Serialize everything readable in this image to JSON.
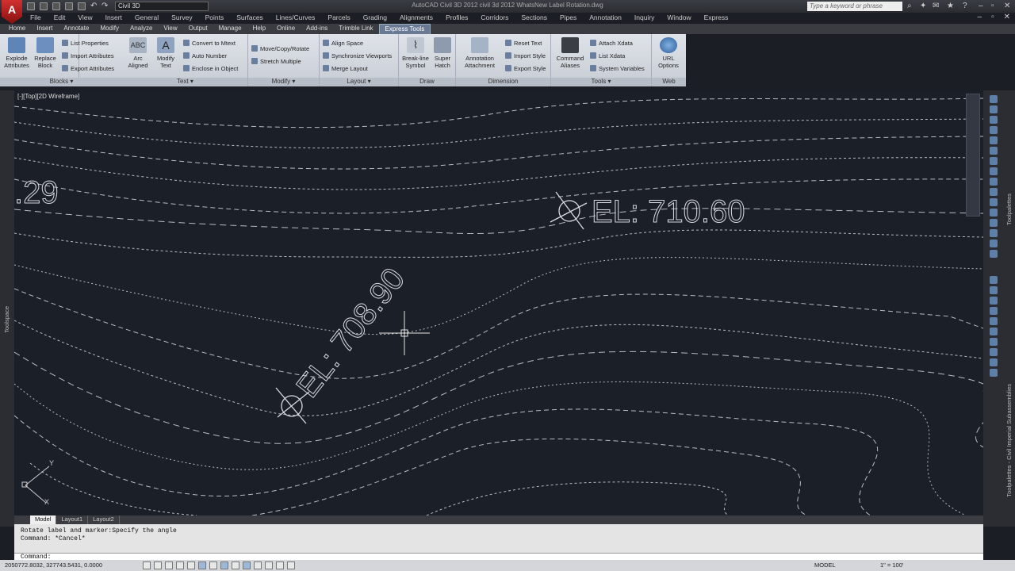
{
  "app": {
    "logo": "A",
    "title": "AutoCAD Civil 3D 2012   civil 3d 2012 WhatsNew Label Rotation.dwg",
    "workspace": "Civil 3D",
    "search_placeholder": "Type a keyword or phrase"
  },
  "menu": [
    "File",
    "Edit",
    "View",
    "Insert",
    "General",
    "Survey",
    "Points",
    "Surfaces",
    "Lines/Curves",
    "Parcels",
    "Grading",
    "Alignments",
    "Profiles",
    "Corridors",
    "Sections",
    "Pipes",
    "Annotation",
    "Inquiry",
    "Window",
    "Express"
  ],
  "ribbon_tabs": [
    "Home",
    "Insert",
    "Annotate",
    "Modify",
    "Analyze",
    "View",
    "Output",
    "Manage",
    "Help",
    "Online",
    "Add-ins",
    "Trimble Link",
    "Express Tools"
  ],
  "active_tab": "Express Tools",
  "ribbon": {
    "blocks": {
      "title": "Blocks",
      "explode": "Explode Attributes",
      "replace": "Replace Block",
      "list_props": "List Properties",
      "import_attr": "Import Attributes",
      "export_attr": "Export Attributes"
    },
    "text": {
      "title": "Text",
      "arc": "Arc Aligned",
      "modify": "Modify Text",
      "convert": "Convert to Mtext",
      "auto_number": "Auto Number",
      "enclose": "Enclose in Object"
    },
    "modify": {
      "title": "Modify",
      "move": "Move/Copy/Rotate",
      "stretch": "Stretch Multiple"
    },
    "layout": {
      "title": "Layout",
      "align": "Align Space",
      "sync": "Synchronize Viewports",
      "merge": "Merge Layout"
    },
    "draw": {
      "title": "Draw",
      "breakline": "Break-line Symbol",
      "hatch": "Super Hatch"
    },
    "dimension": {
      "title": "Dimension",
      "annotation": "Annotation Attachment",
      "reset": "Reset Text",
      "import_style": "Import Style",
      "export_style": "Export Style"
    },
    "tools": {
      "title": "Tools",
      "command_aliases": "Command Aliases",
      "attach_xdata": "Attach Xdata",
      "list_xdata": "List Xdata",
      "system_var": "System Variables"
    },
    "web": {
      "title": "Web",
      "url": "URL Options"
    }
  },
  "viewport": {
    "label": "[-][Top][2D Wireframe]"
  },
  "drawing": {
    "label_partial": ".29",
    "label_horizontal": "EL: 710.60",
    "label_rotated": "EL: 708.90",
    "ucs_x": "X",
    "ucs_y": "Y"
  },
  "palettes": {
    "left": "Toolspace",
    "right_top": "Toolpalettes",
    "right_bottom": "Toolpalettes - Civil Imperial Subassemblies"
  },
  "layout_tabs": [
    "Model",
    "Layout1",
    "Layout2"
  ],
  "command": {
    "line1": "Rotate label and marker:Specify the angle",
    "line2": "Command: *Cancel*",
    "prompt": "Command:"
  },
  "status": {
    "coords": "2050772.8032, 327743.5431, 0.0000",
    "model": "MODEL",
    "scale": "1\" = 100'"
  },
  "colors": {
    "canvas": "#1b1f27",
    "contour": "#b8bcc4",
    "label": "#d8dadf",
    "ribbon": "#d3d7de"
  }
}
